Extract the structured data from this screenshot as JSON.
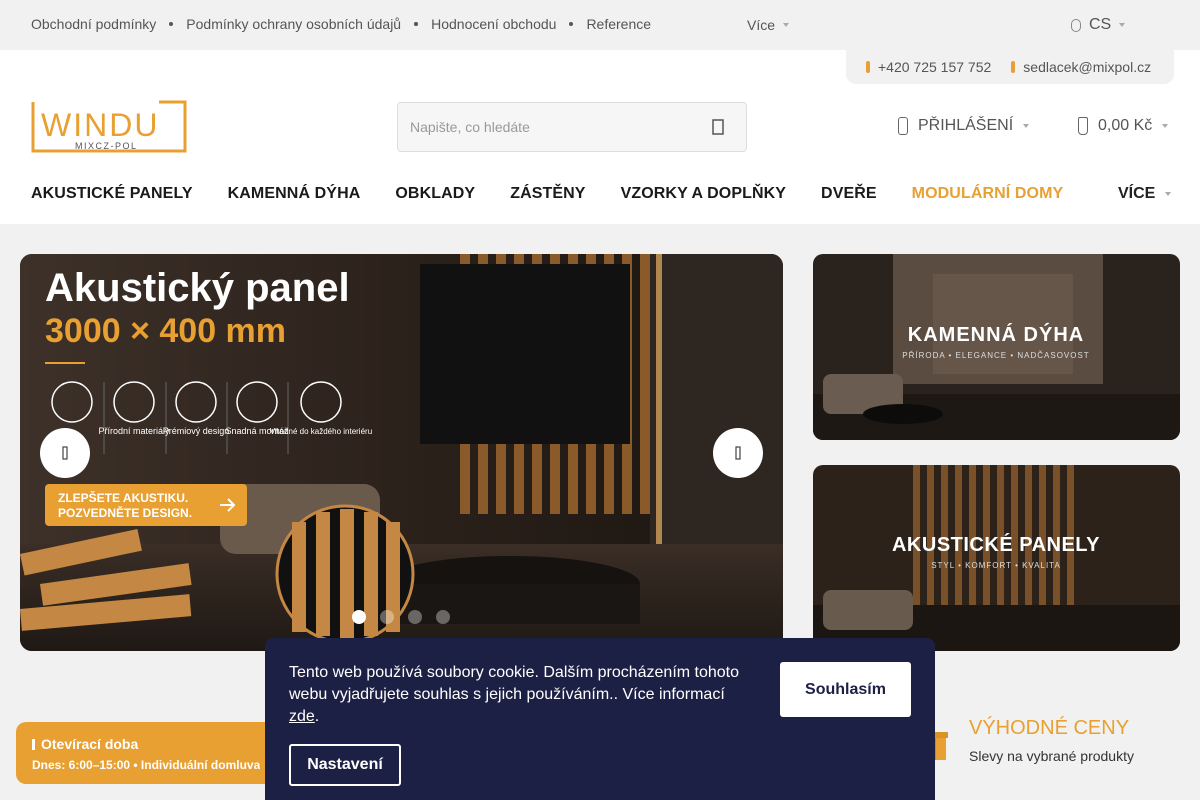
{
  "topbar": {
    "links": [
      "Obchodní podmínky",
      "Podmínky ochrany osobních údajů",
      "Hodnocení obchodu",
      "Reference"
    ],
    "more_label": "Více",
    "language": "CS"
  },
  "header": {
    "phone": "+420 725 157 752",
    "email": "sedlacek@mixpol.cz",
    "logo_text": "WINDU",
    "logo_subtext": "MIXCZ-POL",
    "search_placeholder": "Napište, co hledáte",
    "login_label": "PŘIHLÁŠENÍ",
    "cart_total": "0,00 Kč"
  },
  "nav": {
    "items": [
      "AKUSTICKÉ PANELY",
      "KAMENNÁ DÝHA",
      "OBKLADY",
      "ZÁSTĚNY",
      "VZORKY A DOPLŇKY",
      "DVEŘE",
      "MODULÁRNÍ DOMY"
    ],
    "more_label": "VÍCE"
  },
  "hero": {
    "title": "Akustický panel",
    "size": "3000 × 400 mm",
    "features": [
      "Přírodní materiály",
      "Prémiový design",
      "Snadná montáž",
      "Vhodné do každého interiéru"
    ],
    "feature_first_partial": "...",
    "cta_line1": "ZLEPŠETE AKUSTIKU.",
    "cta_line2": "POZVEDNĚTE DESIGN.",
    "active_slide": 1,
    "slide_count": 4
  },
  "side_banners": [
    {
      "title": "KAMENNÁ DÝHA",
      "subtitle": "PŘÍRODA • ELEGANCE • NADČASOVOST"
    },
    {
      "title": "AKUSTICKÉ PANELY",
      "subtitle": "STYL • KOMFORT • KVALITA"
    }
  ],
  "benefit": {
    "title": "VÝHODNÉ CENY",
    "subtitle": "Slevy na vybrané produkty"
  },
  "hours": {
    "title": "Otevírací doba",
    "line": "Dnes: 6:00–15:00 • Individuální domluva:"
  },
  "cookie": {
    "text": "Tento web používá soubory cookie. Dalším procházením tohoto webu vyjadřujete souhlas s jejich používáním.. Více informací",
    "link": "zde",
    "after_link": ".",
    "agree_label": "Souhlasím",
    "settings_label": "Nastavení"
  },
  "colors": {
    "accent": "#e8a032",
    "cookie_bg": "#1d2045",
    "topbar_bg": "#f1f1f1"
  }
}
